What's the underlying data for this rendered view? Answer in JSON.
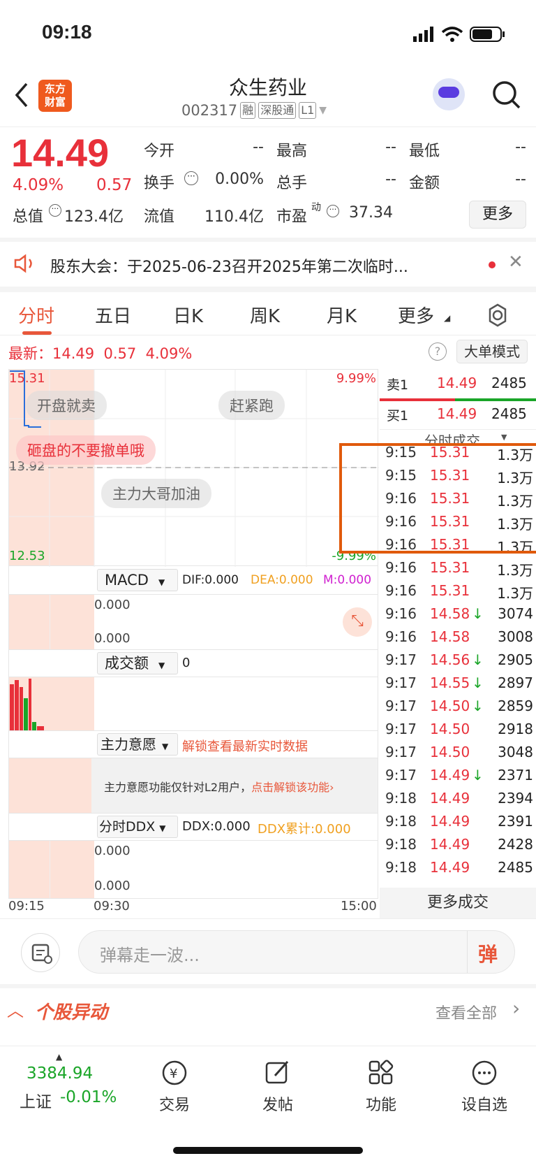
{
  "status": {
    "time": "09:18"
  },
  "header": {
    "logo": "东方财富",
    "name": "众生药业",
    "code": "002317",
    "tags": [
      "融",
      "深股通",
      "L1"
    ]
  },
  "quote": {
    "price": "14.49",
    "pct": "4.09%",
    "chg": "0.57",
    "open_label": "今开",
    "open": "--",
    "high_label": "最高",
    "high": "--",
    "low_label": "最低",
    "low": "--",
    "turnover_label": "换手",
    "turnover": "0.00%",
    "volume_label": "总手",
    "volume": "--",
    "amount_label": "金额",
    "amount": "--",
    "mktcap_label": "总值",
    "mktcap": "123.4亿",
    "float_label": "流值",
    "float": "110.4亿",
    "pe_label": "市盈",
    "pe_sup": "动",
    "pe": "37.34",
    "more": "更多"
  },
  "notice": {
    "text": "股东大会：于2025-06-23召开2025年第二次临时..."
  },
  "tabs": [
    "分时",
    "五日",
    "日K",
    "周K",
    "月K",
    "更多"
  ],
  "latest": {
    "label": "最新：",
    "price": "14.49",
    "chg": "0.57",
    "pct": "4.09%",
    "mode": "大单模式"
  },
  "chart": {
    "high": "15.31",
    "high_pct": "9.99%",
    "mid": "13.92",
    "low": "12.53",
    "low_pct": "-9.99%",
    "bubbles": [
      "开盘就卖",
      "赶紧跑",
      "砸盘的不要撤单哦",
      "主力大哥加油"
    ],
    "macd": {
      "name": "MACD",
      "dif": "DIF:0.000",
      "dea": "DEA:0.000",
      "m": "M:0.000",
      "v1": "0.000",
      "v2": "0.000"
    },
    "amount": {
      "name": "成交额",
      "val": "0"
    },
    "will": {
      "name": "主力意愿",
      "lock": "解锁查看最新实时数据",
      "msg": "主力意愿功能仅针对L2用户，",
      "unlock": "点击解锁该功能"
    },
    "ddx": {
      "name": "分时DDX",
      "ddx": "DDX:0.000",
      "cum": "DDX累计:0.000",
      "v1": "0.000",
      "v2": "0.000"
    },
    "times": [
      "09:15",
      "09:30",
      "15:00"
    ]
  },
  "orderbook": {
    "sell_label": "卖1",
    "sell_price": "14.49",
    "sell_vol": "2485",
    "buy_label": "买1",
    "buy_price": "14.49",
    "buy_vol": "2485",
    "ticks_title": "分时成交"
  },
  "ticks": [
    {
      "t": "9:15",
      "p": "15.31",
      "v": "1.3万",
      "d": ""
    },
    {
      "t": "9:15",
      "p": "15.31",
      "v": "1.3万",
      "d": ""
    },
    {
      "t": "9:16",
      "p": "15.31",
      "v": "1.3万",
      "d": ""
    },
    {
      "t": "9:16",
      "p": "15.31",
      "v": "1.3万",
      "d": ""
    },
    {
      "t": "9:16",
      "p": "15.31",
      "v": "1.3万",
      "d": ""
    },
    {
      "t": "9:16",
      "p": "15.31",
      "v": "1.3万",
      "d": ""
    },
    {
      "t": "9:16",
      "p": "15.31",
      "v": "1.3万",
      "d": ""
    },
    {
      "t": "9:16",
      "p": "14.58",
      "v": "3074",
      "d": "↓"
    },
    {
      "t": "9:16",
      "p": "14.58",
      "v": "3008",
      "d": ""
    },
    {
      "t": "9:17",
      "p": "14.56",
      "v": "2905",
      "d": "↓"
    },
    {
      "t": "9:17",
      "p": "14.55",
      "v": "2897",
      "d": "↓"
    },
    {
      "t": "9:17",
      "p": "14.50",
      "v": "2859",
      "d": "↓"
    },
    {
      "t": "9:17",
      "p": "14.50",
      "v": "2918",
      "d": ""
    },
    {
      "t": "9:17",
      "p": "14.50",
      "v": "3048",
      "d": ""
    },
    {
      "t": "9:17",
      "p": "14.49",
      "v": "2371",
      "d": "↓"
    },
    {
      "t": "9:18",
      "p": "14.49",
      "v": "2394",
      "d": ""
    },
    {
      "t": "9:18",
      "p": "14.49",
      "v": "2391",
      "d": ""
    },
    {
      "t": "9:18",
      "p": "14.49",
      "v": "2428",
      "d": ""
    },
    {
      "t": "9:18",
      "p": "14.49",
      "v": "2485",
      "d": ""
    }
  ],
  "more_trades": "更多成交",
  "danmu": {
    "placeholder": "弹幕走一波...",
    "send": "弹"
  },
  "movers": {
    "title": "个股异动",
    "all": "查看全部"
  },
  "nav": {
    "index_val": "3384.94",
    "index_name": "上证",
    "index_pct": "-0.01%",
    "items": [
      "交易",
      "发帖",
      "功能",
      "设自选"
    ]
  }
}
